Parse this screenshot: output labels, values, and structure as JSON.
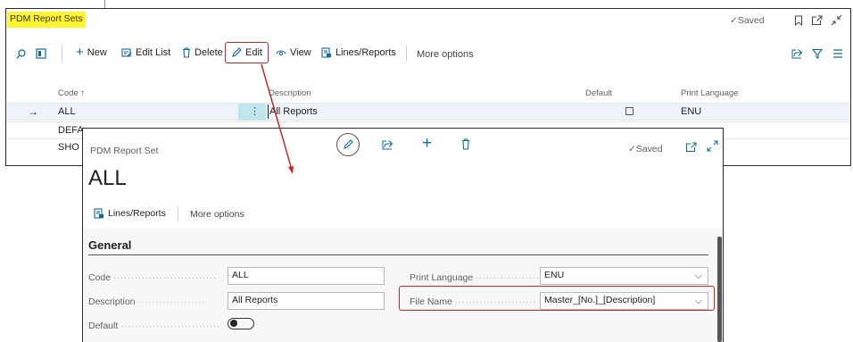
{
  "list_page": {
    "title": "PDM Report Sets",
    "saved": "Saved",
    "toolbar": {
      "new_label": "New",
      "edit_list_label": "Edit List",
      "delete_label": "Delete",
      "edit_label": "Edit",
      "view_label": "View",
      "lines_reports_label": "Lines/Reports",
      "more_options_label": "More options"
    },
    "columns": [
      "Code ↑",
      "Description",
      "Default",
      "Print Language"
    ],
    "rows": [
      {
        "code": "ALL",
        "description": "All Reports",
        "print_language": "ENU"
      },
      {
        "code": "DEFA"
      },
      {
        "code": "SHO"
      }
    ]
  },
  "card": {
    "caption": "PDM Report Set",
    "title": "ALL",
    "saved": "Saved",
    "actions": {
      "lines_reports_label": "Lines/Reports",
      "more_options_label": "More options"
    },
    "section": "General",
    "fields": {
      "code": {
        "label": "Code",
        "value": "ALL"
      },
      "description": {
        "label": "Description",
        "value": "All Reports"
      },
      "default": {
        "label": "Default",
        "value": false
      },
      "print_language": {
        "label": "Print Language",
        "value": "ENU"
      },
      "file_name": {
        "label": "File Name",
        "value": "Master_[No.]_[Description]"
      }
    }
  },
  "colors": {
    "highlight": "#fff52e",
    "annotation": "#c62828",
    "selection": "#eef3fa"
  }
}
